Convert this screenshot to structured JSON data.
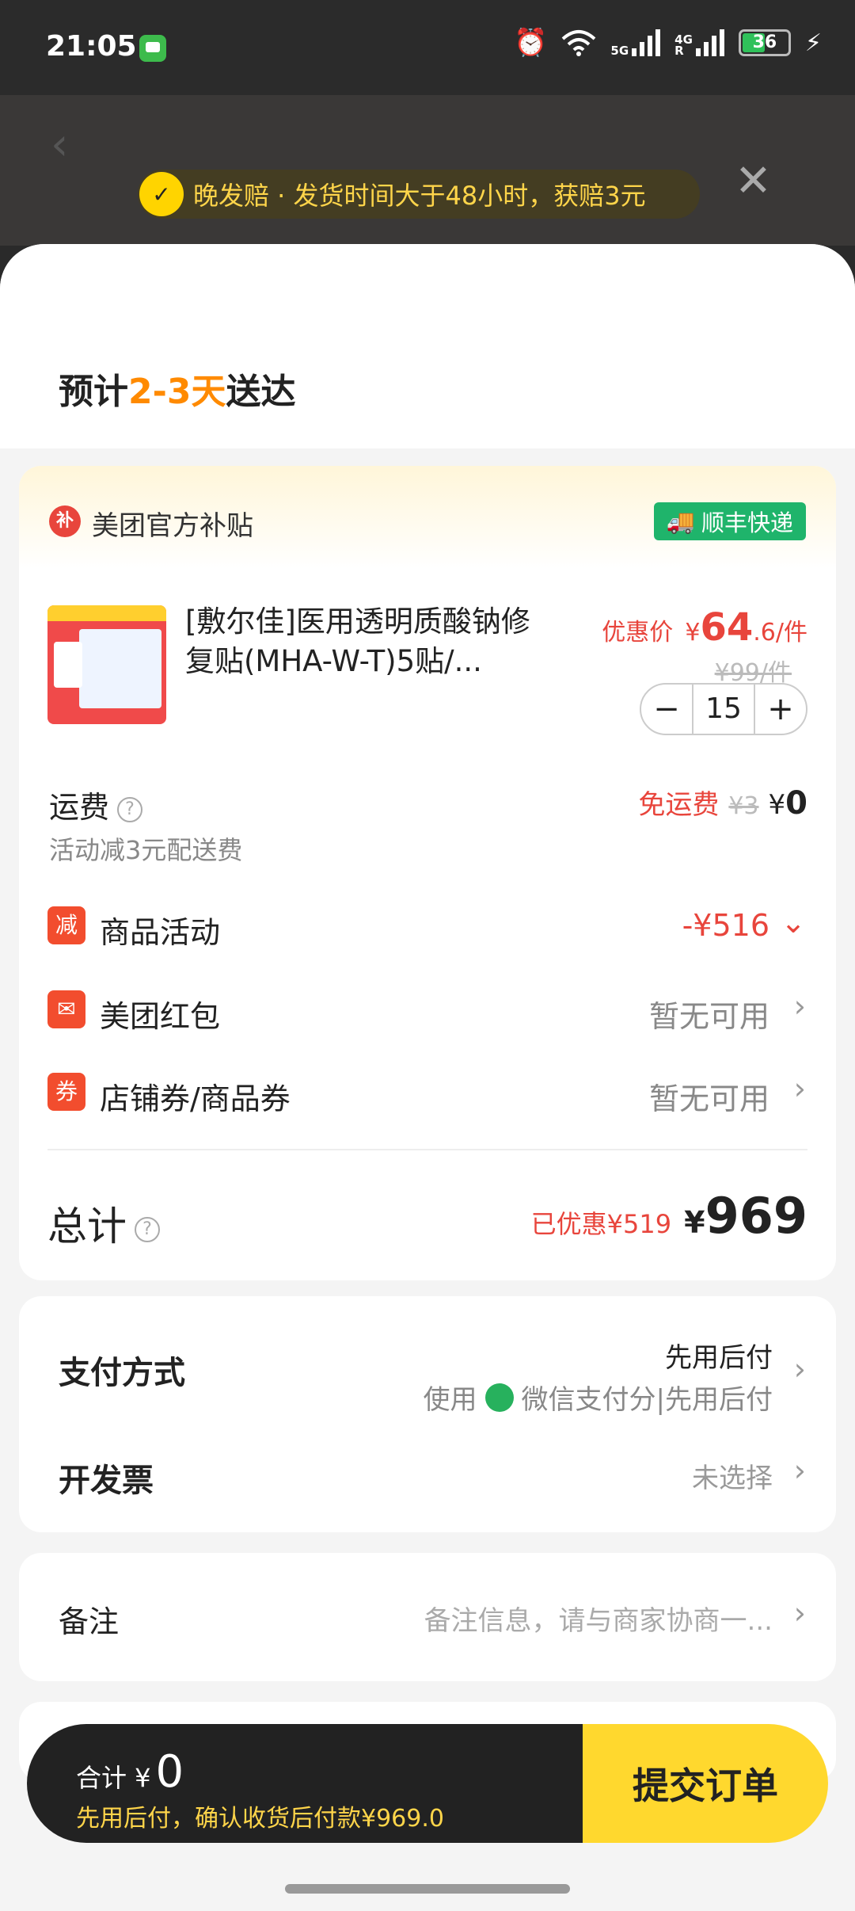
{
  "status_bar": {
    "time": "21:05",
    "signal1_label": "5G",
    "signal2_label": "4G",
    "signal2_roaming": "R",
    "battery": "36"
  },
  "banner": {
    "text": "晚发赔 · 发货时间大于48小时，获赔3元",
    "badge_glyph": "✓",
    "close_glyph": "✕"
  },
  "delivery": {
    "prefix": "预计",
    "highlight": "2-3天",
    "suffix": "送达"
  },
  "subsidy": {
    "icon_glyph": "补",
    "label": "美团官方补贴",
    "shipping_badge": "顺丰快递"
  },
  "product": {
    "title": "[敷尔佳]医用透明质酸钠修复贴(MHA-W-T)5贴/...",
    "price_label": "优惠价",
    "price_yen": "¥",
    "price_int": "64",
    "price_dec": ".6",
    "price_unit": "/件",
    "original_price": "¥99/件",
    "quantity": "15",
    "minus": "−",
    "plus": "+"
  },
  "shipping_fee": {
    "label": "运费",
    "sub": "活动减3元配送费",
    "free_label": "免运费",
    "original": "¥3",
    "yen": "¥",
    "value": "0"
  },
  "rows": {
    "activity": {
      "icon": "减",
      "label": "商品活动",
      "value": "-¥516",
      "chevron": "⌄"
    },
    "redpacket": {
      "label": "美团红包",
      "value": "暂无可用",
      "chevron": "›"
    },
    "coupon": {
      "icon": "券",
      "label": "店铺券/商品券",
      "value": "暂无可用",
      "chevron": "›"
    }
  },
  "total": {
    "label": "总计",
    "saved": "已优惠¥519",
    "yen": "¥",
    "amount": "969"
  },
  "payment": {
    "label": "支付方式",
    "line1": "先用后付",
    "use": "使用",
    "method": "微信支付分|先用后付",
    "chevron": "›"
  },
  "invoice": {
    "label": "开发票",
    "value": "未选择",
    "chevron": "›"
  },
  "note": {
    "label": "备注",
    "placeholder": "备注信息，请与商家协商一...",
    "chevron": "›"
  },
  "bottom": {
    "total_label": "合计 ¥",
    "total_value": "0",
    "sub": "先用后付，确认收货后付款¥969.0",
    "submit": "提交订单"
  },
  "colors": {
    "accent_red": "#e8453c",
    "accent_orange": "#ff8a00",
    "sf_green": "#1fb46b",
    "submit_yellow": "#ffd82e"
  }
}
